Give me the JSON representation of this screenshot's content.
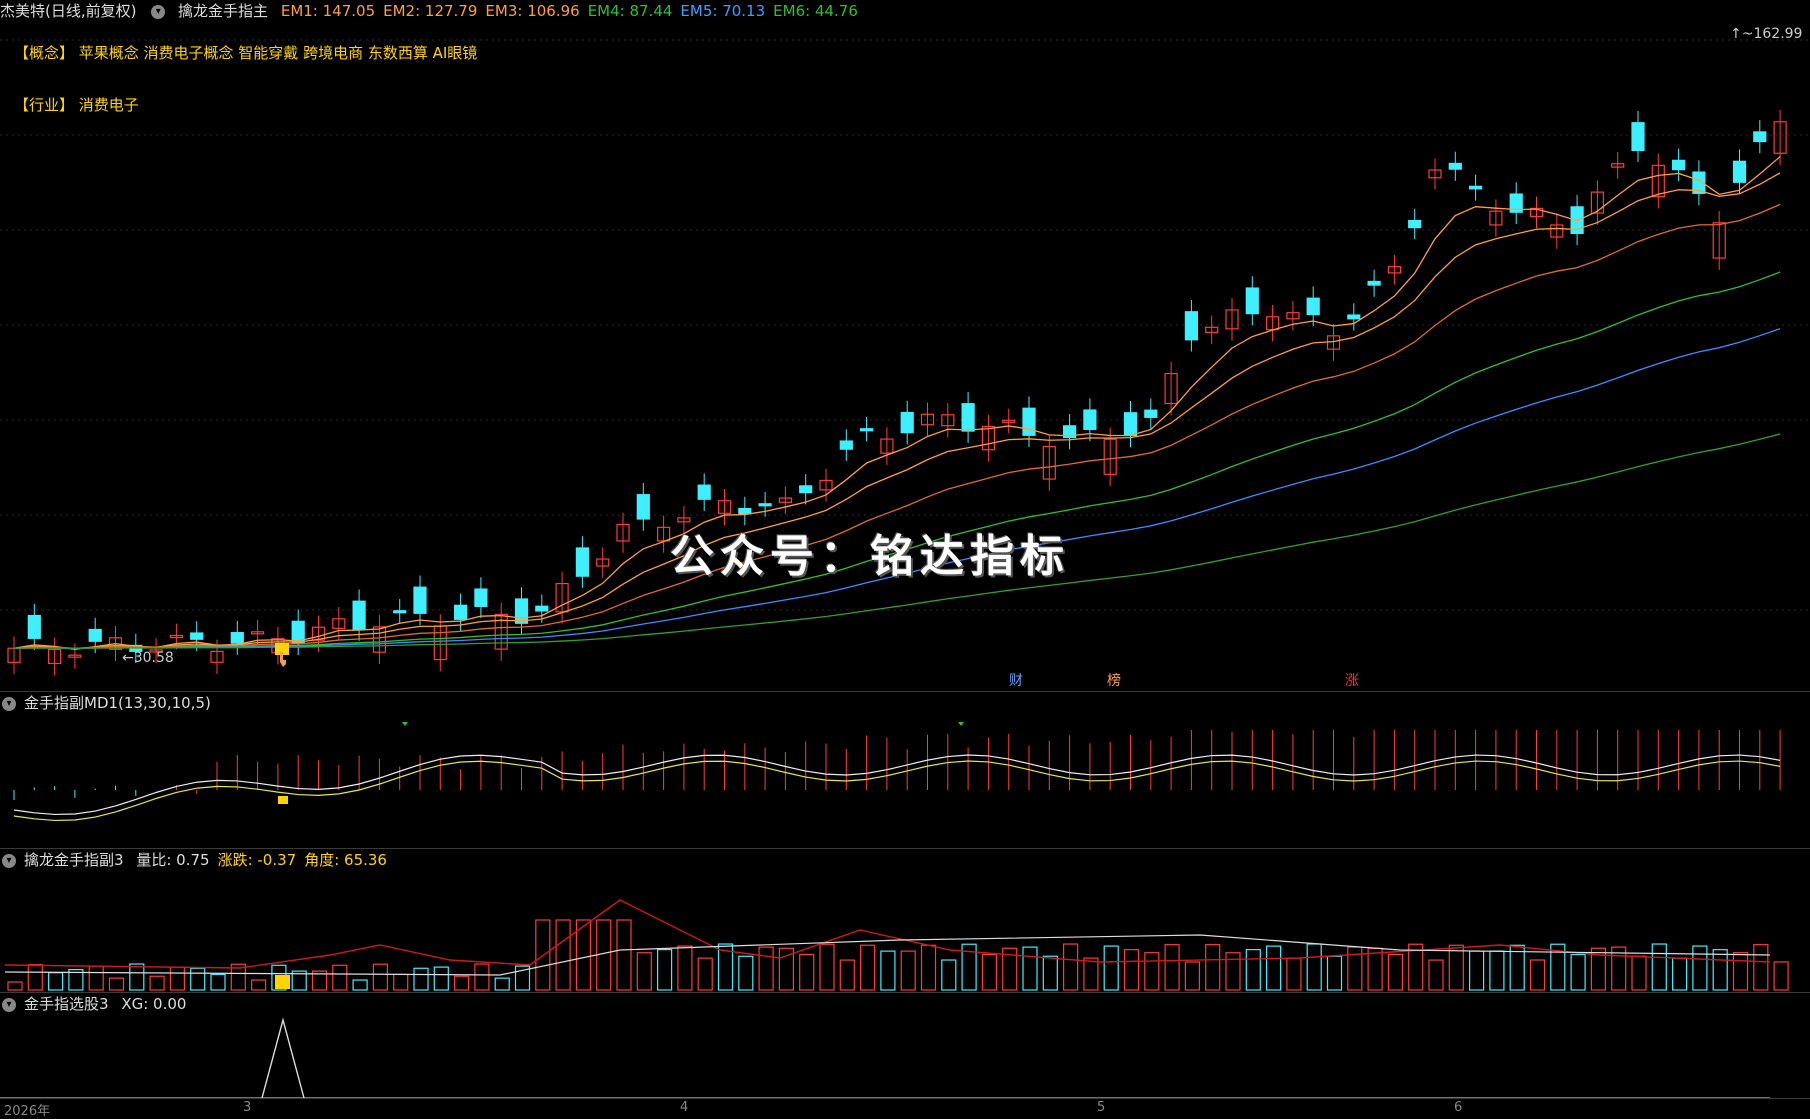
{
  "main_header": {
    "stock": "杰美特(日线,前复权)",
    "indicator": "擒龙金手指主",
    "em": [
      {
        "label": "EM1: 147.05",
        "color": "#ff9f3a"
      },
      {
        "label": "EM2: 127.79",
        "color": "#ff9f3a"
      },
      {
        "label": "EM3: 106.96",
        "color": "#ff9f3a"
      },
      {
        "label": "EM4: 87.44",
        "color": "#2fbf2f"
      },
      {
        "label": "EM5: 70.13",
        "color": "#3aa0ff"
      },
      {
        "label": "EM6: 44.76",
        "color": "#2fbf2f"
      }
    ]
  },
  "concept_line": "【概念】 苹果概念 消费电子概念 智能穿戴 跨境电商 东数西算 AI眼镜",
  "industry_line": "【行业】 消费电子",
  "price_high_label": "162.99",
  "price_low_label": "30.58",
  "watermark": "公众号：铭达指标",
  "badges": [
    {
      "text": "财",
      "color": "#5aa0ff"
    },
    {
      "text": "榜",
      "color": "#ff9f3a"
    },
    {
      "text": "涨",
      "color": "#ff3030"
    }
  ],
  "sub1_header": "金手指副MD1(13,30,10,5)",
  "sub2_header": {
    "name": "擒龙金手指副3",
    "items": [
      {
        "label": "量比: 0.75",
        "color": "#dddddd"
      },
      {
        "label": "涨跌: -0.37",
        "color": "#ffd400"
      },
      {
        "label": "角度: 65.36",
        "color": "#ffd400"
      }
    ]
  },
  "sub3_header": {
    "name": "金手指选股3",
    "value": "XG: 0.00"
  },
  "x_labels": [
    "2026年",
    "3",
    "4",
    "5",
    "6"
  ],
  "colors": {
    "up": "#ff3b3b",
    "down": "#3ef0ff",
    "bg": "#000000"
  }
}
